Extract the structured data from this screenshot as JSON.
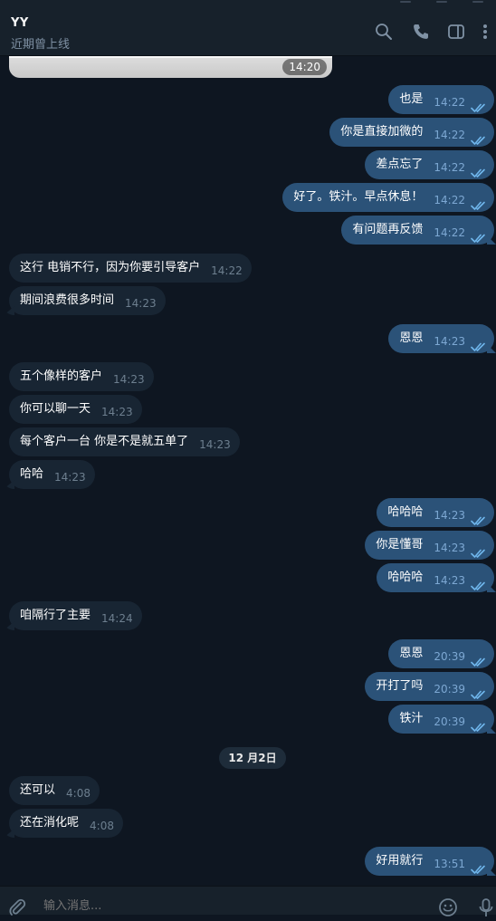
{
  "header": {
    "title": "YY",
    "status": "近期曾上线",
    "icons": [
      "search-icon",
      "phone-icon",
      "sidebar-toggle-icon",
      "more-vertical-icon"
    ]
  },
  "image_message": {
    "time": "14:20"
  },
  "messages": [
    {
      "dir": "out",
      "text": "也是",
      "time": "14:22",
      "read": true
    },
    {
      "dir": "out",
      "text": "你是直接加微的",
      "time": "14:22",
      "read": true
    },
    {
      "dir": "out",
      "text": "差点忘了",
      "time": "14:22",
      "read": true
    },
    {
      "dir": "out",
      "text": "好了。铁汁。早点休息！",
      "time": "14:22",
      "read": true
    },
    {
      "dir": "out",
      "text": "有问题再反馈",
      "time": "14:22",
      "read": true
    },
    {
      "dir": "in",
      "text": "这行 电销不行，因为你要引导客户",
      "time": "14:22"
    },
    {
      "dir": "in",
      "text": "期间浪费很多时间",
      "time": "14:23"
    },
    {
      "dir": "out",
      "text": "恩恩",
      "time": "14:23",
      "read": true
    },
    {
      "dir": "in",
      "text": "五个像样的客户",
      "time": "14:23"
    },
    {
      "dir": "in",
      "text": "你可以聊一天",
      "time": "14:23"
    },
    {
      "dir": "in",
      "text": "每个客户一台 你是不是就五单了",
      "time": "14:23"
    },
    {
      "dir": "in",
      "text": "哈哈",
      "time": "14:23"
    },
    {
      "dir": "out",
      "text": "哈哈哈",
      "time": "14:23",
      "read": true
    },
    {
      "dir": "out",
      "text": "你是懂哥",
      "time": "14:23",
      "read": true
    },
    {
      "dir": "out",
      "text": "哈哈哈",
      "time": "14:23",
      "read": true
    },
    {
      "dir": "in",
      "text": "咱隔行了主要",
      "time": "14:24"
    },
    {
      "dir": "out",
      "text": "恩恩",
      "time": "20:39",
      "read": true
    },
    {
      "dir": "out",
      "text": "开打了吗",
      "time": "20:39",
      "read": true
    },
    {
      "dir": "out",
      "text": "铁汁",
      "time": "20:39",
      "read": true
    },
    {
      "dir": "in",
      "text": "还可以",
      "time": "4:08"
    },
    {
      "dir": "in",
      "text": "还在消化呢",
      "time": "4:08"
    },
    {
      "dir": "out",
      "text": "好用就行",
      "time": "13:51",
      "read": true
    }
  ],
  "date_separator": "12 月2日",
  "composer": {
    "placeholder": "输入消息...",
    "icons": [
      "paperclip-icon",
      "emoji-icon",
      "microphone-icon"
    ]
  },
  "colors": {
    "background": "#0e1621",
    "header": "#17212b",
    "incoming_bubble": "#182533",
    "outgoing_bubble": "#2b5278",
    "outgoing_time": "#7da8d3",
    "incoming_time": "#6d7f8f",
    "read_check": "#6fb6ec"
  }
}
